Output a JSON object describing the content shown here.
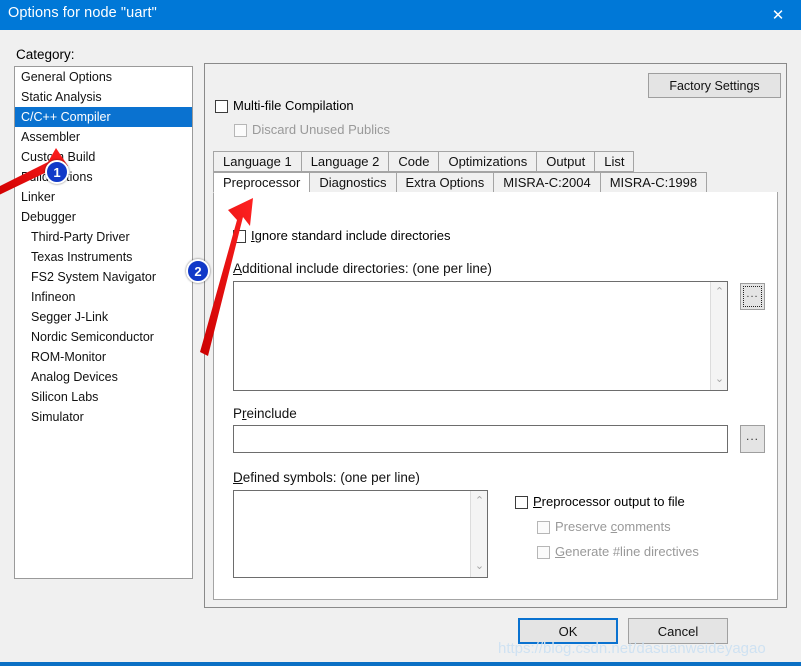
{
  "window": {
    "title": "Options for node \"uart\"",
    "close_icon": "✕",
    "titlebar_color": "#0078d7"
  },
  "category": {
    "label": "Category:",
    "items": [
      {
        "label": "General Options",
        "indent": false,
        "selected": false
      },
      {
        "label": "Static Analysis",
        "indent": false,
        "selected": false
      },
      {
        "label": "C/C++ Compiler",
        "indent": false,
        "selected": true
      },
      {
        "label": "Assembler",
        "indent": false,
        "selected": false
      },
      {
        "label": "Custom Build",
        "indent": false,
        "selected": false
      },
      {
        "label": "Build Actions",
        "indent": false,
        "selected": false
      },
      {
        "label": "Linker",
        "indent": false,
        "selected": false
      },
      {
        "label": "Debugger",
        "indent": false,
        "selected": false
      },
      {
        "label": "Third-Party Driver",
        "indent": true,
        "selected": false
      },
      {
        "label": "Texas Instruments",
        "indent": true,
        "selected": false
      },
      {
        "label": "FS2 System Navigator",
        "indent": true,
        "selected": false
      },
      {
        "label": "Infineon",
        "indent": true,
        "selected": false
      },
      {
        "label": "Segger J-Link",
        "indent": true,
        "selected": false
      },
      {
        "label": "Nordic Semiconductor",
        "indent": true,
        "selected": false
      },
      {
        "label": "ROM-Monitor",
        "indent": true,
        "selected": false
      },
      {
        "label": "Analog Devices",
        "indent": true,
        "selected": false
      },
      {
        "label": "Silicon Labs",
        "indent": true,
        "selected": false
      },
      {
        "label": "Simulator",
        "indent": true,
        "selected": false
      }
    ]
  },
  "panel": {
    "factory_settings_label": "Factory Settings",
    "multifile_label": "Multi-file Compilation",
    "multifile_checked": false,
    "discard_label": "Discard Unused Publics",
    "discard_checked": false,
    "discard_disabled": true
  },
  "tabs": {
    "row1": [
      {
        "label": "Language 1",
        "active": false
      },
      {
        "label": "Language 2",
        "active": false
      },
      {
        "label": "Code",
        "active": false
      },
      {
        "label": "Optimizations",
        "active": false
      },
      {
        "label": "Output",
        "active": false
      },
      {
        "label": "List",
        "active": false
      }
    ],
    "row2": [
      {
        "label": "Preprocessor",
        "active": true
      },
      {
        "label": "Diagnostics",
        "active": false
      },
      {
        "label": "Extra Options",
        "active": false
      },
      {
        "label": "MISRA-C:2004",
        "active": false
      },
      {
        "label": "MISRA-C:1998",
        "active": false
      }
    ]
  },
  "preprocessor": {
    "ignore_std_label": "Ignore standard include directories",
    "ignore_std_checked": false,
    "additional_label": "Additional include directories: (one per line)",
    "additional_value": "",
    "preinclude_label": "Preinclude",
    "preinclude_value": "",
    "defined_label": "Defined symbols: (one per line)",
    "defined_value": "",
    "browse_label": "...",
    "ppout_label": "Preprocessor output to file",
    "ppout_checked": false,
    "preserve_label": "Preserve comments",
    "preserve_checked": false,
    "preserve_disabled": true,
    "genline_label": "Generate #line directives",
    "genline_checked": false,
    "genline_disabled": true,
    "scroll_up_icon": "⌃",
    "scroll_down_icon": "⌄"
  },
  "footer": {
    "ok_label": "OK",
    "cancel_label": "Cancel"
  },
  "annotations": {
    "badge_1": "1",
    "badge_2": "2",
    "arrow_color": "#ee1111"
  },
  "watermark": "https://blog.csdn.net/dasuanweideyagao"
}
